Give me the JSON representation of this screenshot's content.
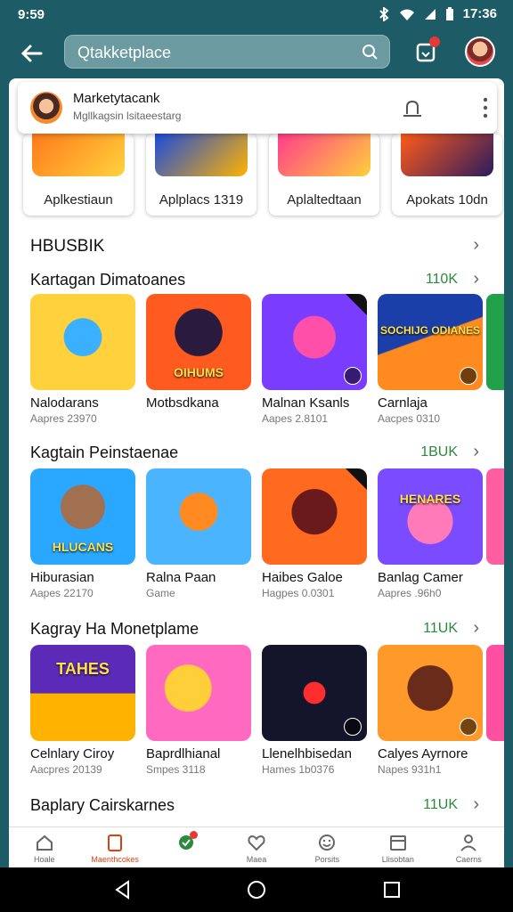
{
  "status": {
    "time_left": "9:59",
    "time_right": "17:36",
    "icons": [
      "bluetooth-icon",
      "wifi-icon",
      "signal-icon",
      "battery-icon"
    ]
  },
  "appbar": {
    "search_text": "Qtakketplace",
    "back_icon": "arrow-left-icon",
    "search_icon": "search-icon",
    "inbox_icon": "inbox-icon",
    "avatar": "user-avatar"
  },
  "account_card": {
    "title": "Marketytacank",
    "subtitle": "Mgllkagsin lsitaeestarg",
    "action_icon": "edit-icon",
    "more_icon": "more-vert-icon"
  },
  "top_apps": [
    {
      "label": "Aplkestiaun",
      "colors": [
        "#ff7a1a",
        "#ffd23d"
      ]
    },
    {
      "label": "Aplplacs 1319",
      "colors": [
        "#1a4bdc",
        "#ffb300"
      ]
    },
    {
      "label": "Aplaltedtaan",
      "colors": [
        "#ff3d8b",
        "#ffcf3a"
      ]
    },
    {
      "label": "Apokats 10dn",
      "colors": [
        "#ff5b1a",
        "#2b1c5e"
      ]
    }
  ],
  "header_section": {
    "title": "HBUSBIK"
  },
  "sections": [
    {
      "title": "Kartagan Dimatoanes",
      "count": "110K",
      "items": [
        {
          "name": "Nalodarans",
          "meta": "Aapres 23970",
          "art": "",
          "colors": [
            "#ffd23d",
            "#3bb0ff"
          ]
        },
        {
          "name": "Motbsdkana",
          "meta": "",
          "art": "OIHUMS",
          "colors": [
            "#ff5a1f",
            "#2a1a3d"
          ]
        },
        {
          "name": "Malnan Ksanls",
          "meta": "Aapes 2.8101",
          "art": "",
          "colors": [
            "#7a3dff",
            "#ff4fa8"
          ]
        },
        {
          "name": "Carnlaja",
          "meta": "Aacpes 0310",
          "art": "SOCHIJG ODIANES",
          "colors": [
            "#1a3fa8",
            "#ff8a1f"
          ]
        }
      ],
      "peek_color": "#22a04a"
    },
    {
      "title": "Kagtain Peinstaenae",
      "count": "1BUK",
      "items": [
        {
          "name": "Hiburasian",
          "meta": "Aapes 22170",
          "art": "HLUCANS",
          "colors": [
            "#2aa8ff",
            "#ffcf3a"
          ]
        },
        {
          "name": "Ralna Paan",
          "meta": "Game",
          "art": "",
          "colors": [
            "#4ab4ff",
            "#ff8a1f"
          ]
        },
        {
          "name": "Haibes Galoe",
          "meta": "Hagpes 0.0301",
          "art": "",
          "colors": [
            "#ff6a1f",
            "#6a1a1a"
          ]
        },
        {
          "name": "Banlag Camer",
          "meta": "Aapres .96h0",
          "art": "HENARES",
          "colors": [
            "#7a4bff",
            "#ff7ab8"
          ]
        }
      ],
      "peek_color": "#ff5fa0"
    },
    {
      "title": "Kagray Ha Monetplame",
      "count": "11UK",
      "items": [
        {
          "name": "Celnlary Ciroy",
          "meta": "Aacpres 20139",
          "art": "TAHES",
          "colors": [
            "#5b2bb8",
            "#ffb300"
          ]
        },
        {
          "name": "Baprdlhianal",
          "meta": "Smpes 3118",
          "art": "",
          "colors": [
            "#ff6ac0",
            "#ffcf3a"
          ]
        },
        {
          "name": "Llenelhbisedan",
          "meta": "Hames 1b0376",
          "art": "",
          "colors": [
            "#14142a",
            "#ff2d2d"
          ]
        },
        {
          "name": "Calyes Ayrnore",
          "meta": "Napes 931h1",
          "art": "",
          "colors": [
            "#ff9a2a",
            "#6a2c1a"
          ]
        }
      ],
      "peek_color": "#ff4fa0"
    },
    {
      "title": "Baplary Cairskarnes",
      "count": "11UK",
      "items": [],
      "peek_color": "#ffffff"
    }
  ],
  "bottom_nav": [
    {
      "label": "Hoale",
      "icon": "home-icon",
      "active": false
    },
    {
      "label": "Maenthcokes",
      "icon": "book-icon",
      "active": true
    },
    {
      "label": "",
      "icon": "explore-pin-icon",
      "active": false,
      "dot": true
    },
    {
      "label": "Maea",
      "icon": "heart-icon",
      "active": false
    },
    {
      "label": "Porsits",
      "icon": "smile-icon",
      "active": false
    },
    {
      "label": "Llisobtan",
      "icon": "calendar-icon",
      "active": false
    },
    {
      "label": "Caerns",
      "icon": "person-icon",
      "active": false
    }
  ],
  "system_nav": {
    "back": "back-triangle-icon",
    "home": "home-circle-icon",
    "recents": "recents-square-icon"
  }
}
